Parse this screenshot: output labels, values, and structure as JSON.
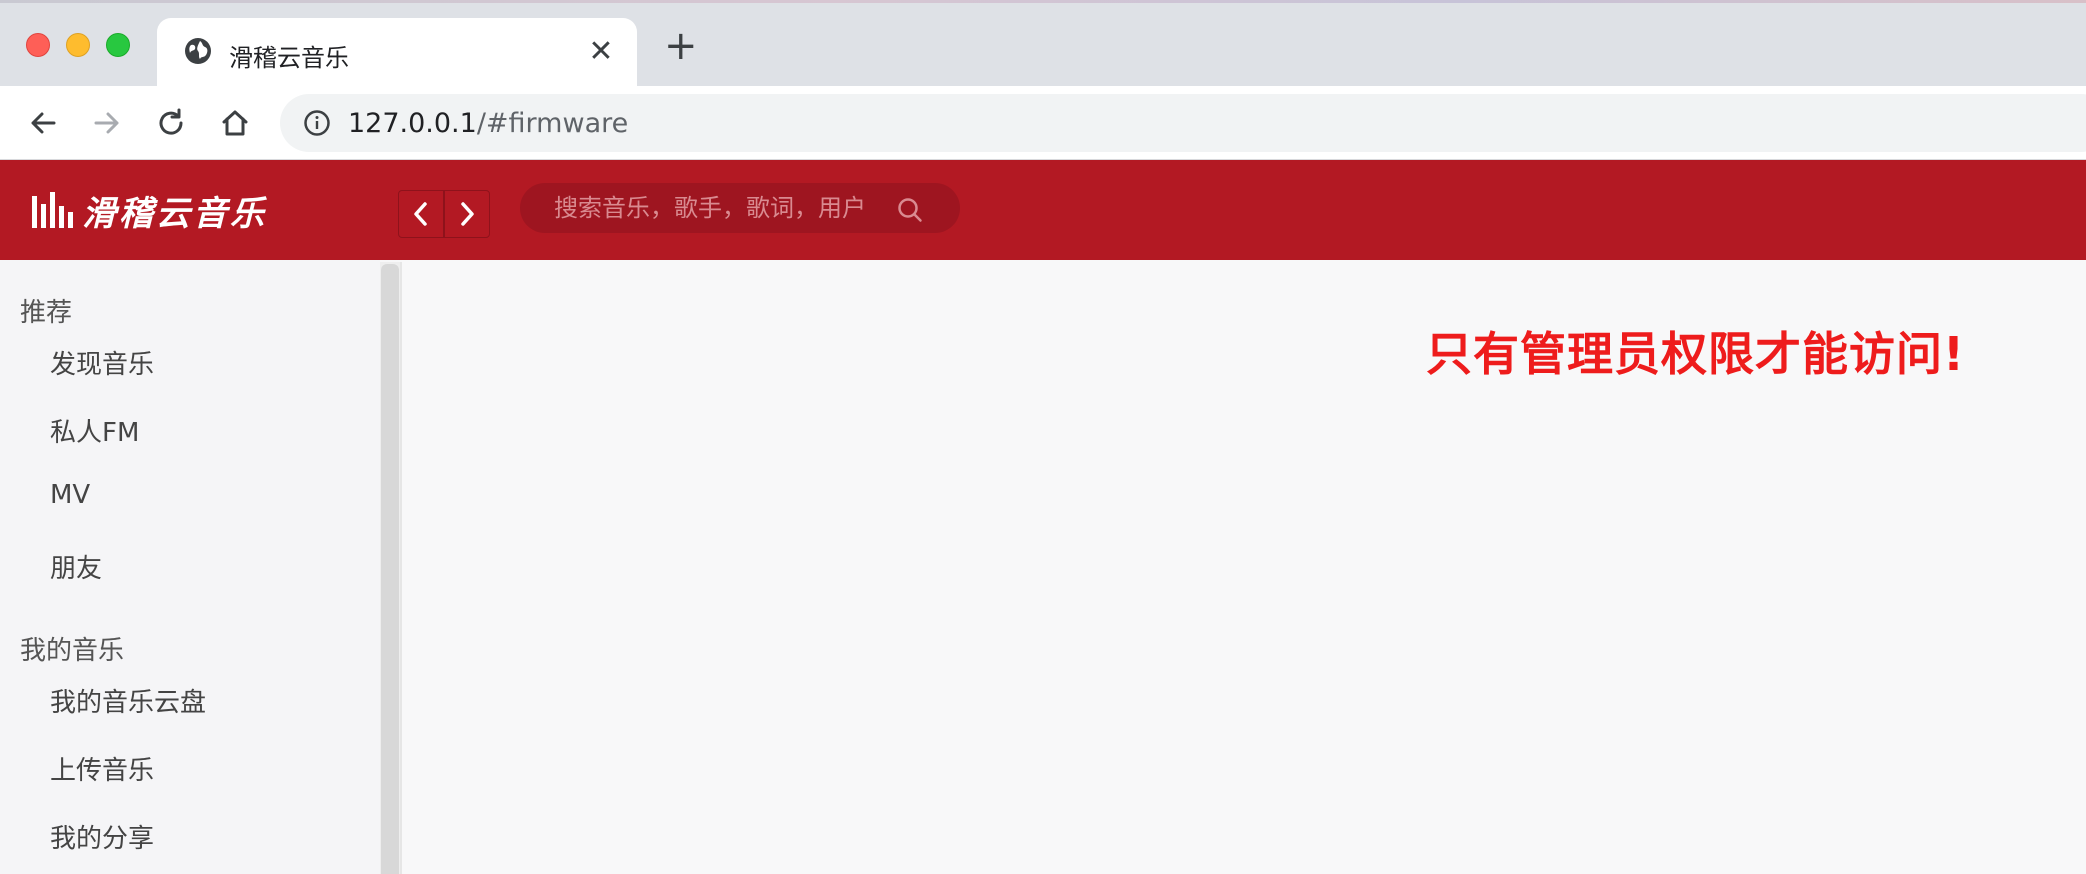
{
  "browser": {
    "tab_title": "滑稽云音乐",
    "tab_close": "✕",
    "new_tab": "+",
    "url_host": "127.0.0.1",
    "url_path": "/#firmware"
  },
  "header": {
    "logo_text": "滑稽云音乐",
    "search_placeholder": "搜索音乐，歌手，歌词，用户",
    "brand_color": "#b31923"
  },
  "sidebar": {
    "sections": [
      {
        "title": "推荐",
        "items": [
          "发现音乐",
          "私人FM",
          "MV",
          "朋友"
        ]
      },
      {
        "title": "我的音乐",
        "items": [
          "我的音乐云盘",
          "上传音乐",
          "我的分享"
        ]
      }
    ]
  },
  "main": {
    "message": "只有管理员权限才能访问!",
    "message_color": "#ee1c1c"
  }
}
